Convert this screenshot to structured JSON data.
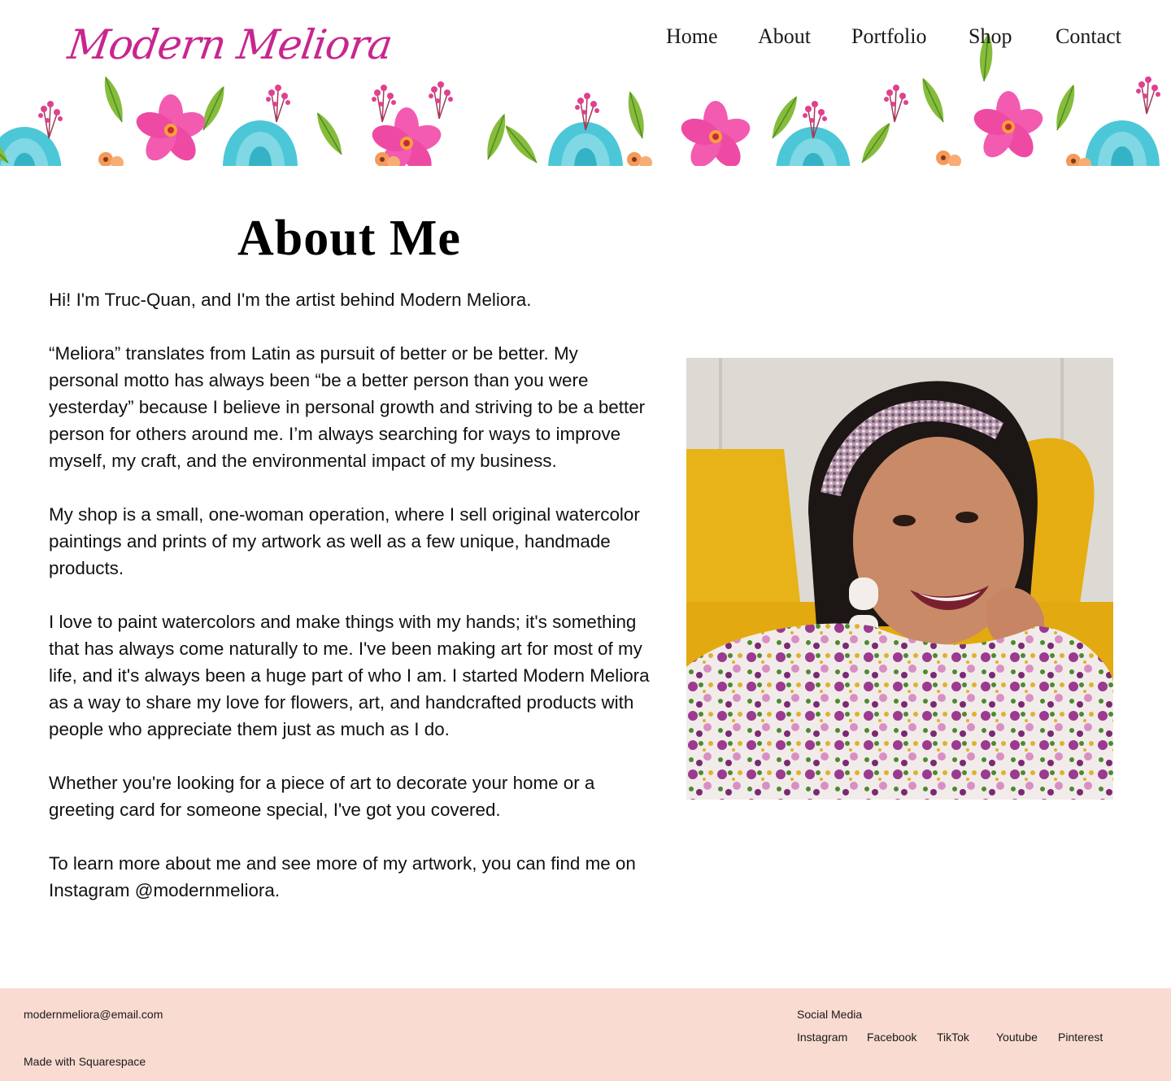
{
  "header": {
    "logo_text": "Modern Meliora",
    "nav": [
      {
        "label": "Home"
      },
      {
        "label": "About"
      },
      {
        "label": "Portfolio"
      },
      {
        "label": "Shop"
      },
      {
        "label": "Contact"
      }
    ]
  },
  "main": {
    "title": "About Me",
    "paragraphs": [
      "Hi! I'm Truc-Quan, and I'm the artist behind Modern Meliora.",
      "“Meliora” translates from Latin as pursuit of better or be better. My personal motto has always been “be a better person than you were yesterday” because I believe in personal growth and striving to be a better person for others around me. I’m always searching for ways to improve myself, my craft, and the environmental impact of my business.",
      "My shop is a small, one-woman operation, where I sell original watercolor paintings and prints of my artwork as well as a few unique, handmade products.",
      "I love to paint watercolors and make things with my hands; it's something that has always come naturally to me. I've been making art for most of my life, and it's always been a huge part of who I am. I started Modern Meliora as a way to share my love for flowers, art, and handcrafted products with people who appreciate them just as much as I do.",
      "Whether you're looking for a piece of art to decorate your home or a greeting card for someone special, I've got you covered.",
      "To learn more about me and see more of my artwork, you can find me on Instagram @modernmeliora."
    ]
  },
  "footer": {
    "email": "modernmeliora@email.com",
    "made_with": "Made with Squarespace",
    "social_heading": "Social Media",
    "social_links": [
      {
        "label": "Instagram"
      },
      {
        "label": "Facebook"
      },
      {
        "label": "TikTok"
      },
      {
        "label": "Youtube"
      },
      {
        "label": "Pinterest"
      }
    ]
  },
  "colors": {
    "logo": "#c8268f",
    "footer_bg": "#f9dbd1",
    "flower_pink": "#f25bb0",
    "flower_teal": "#3fc1d3",
    "leaf_green": "#7db33a",
    "flower_orange": "#f59a5a",
    "chair_yellow": "#e9b416"
  }
}
